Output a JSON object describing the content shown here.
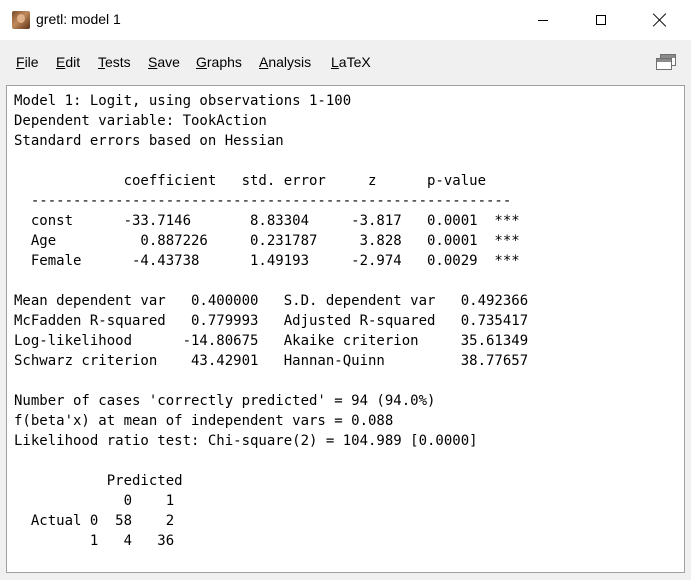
{
  "window": {
    "title": "gretl: model 1"
  },
  "menu": {
    "items": [
      {
        "accel": "F",
        "rest": "ile"
      },
      {
        "accel": "E",
        "rest": "dit"
      },
      {
        "accel": "T",
        "rest": "ests"
      },
      {
        "accel": "S",
        "rest": "ave"
      },
      {
        "accel": "G",
        "rest": "raphs"
      },
      {
        "accel": "A",
        "rest": "nalysis"
      },
      {
        "accel": "L",
        "rest": "aTeX"
      }
    ]
  },
  "output": {
    "lines": [
      "Model 1: Logit, using observations 1-100",
      "Dependent variable: TookAction",
      "Standard errors based on Hessian",
      "",
      "             coefficient   std. error     z      p-value",
      "  ---------------------------------------------------------",
      "  const      -33.7146       8.83304     -3.817   0.0001  ***",
      "  Age          0.887226     0.231787     3.828   0.0001  ***",
      "  Female      -4.43738      1.49193     -2.974   0.0029  ***",
      "",
      "Mean dependent var   0.400000   S.D. dependent var   0.492366",
      "McFadden R-squared   0.779993   Adjusted R-squared   0.735417",
      "Log-likelihood      -14.80675   Akaike criterion     35.61349",
      "Schwarz criterion    43.42901   Hannan-Quinn         38.77657",
      "",
      "Number of cases 'correctly predicted' = 94 (94.0%)",
      "f(beta'x) at mean of independent vars = 0.088",
      "Likelihood ratio test: Chi-square(2) = 104.989 [0.0000]",
      "",
      "           Predicted",
      "             0    1",
      "  Actual 0  58    2",
      "         1   4   36"
    ]
  }
}
